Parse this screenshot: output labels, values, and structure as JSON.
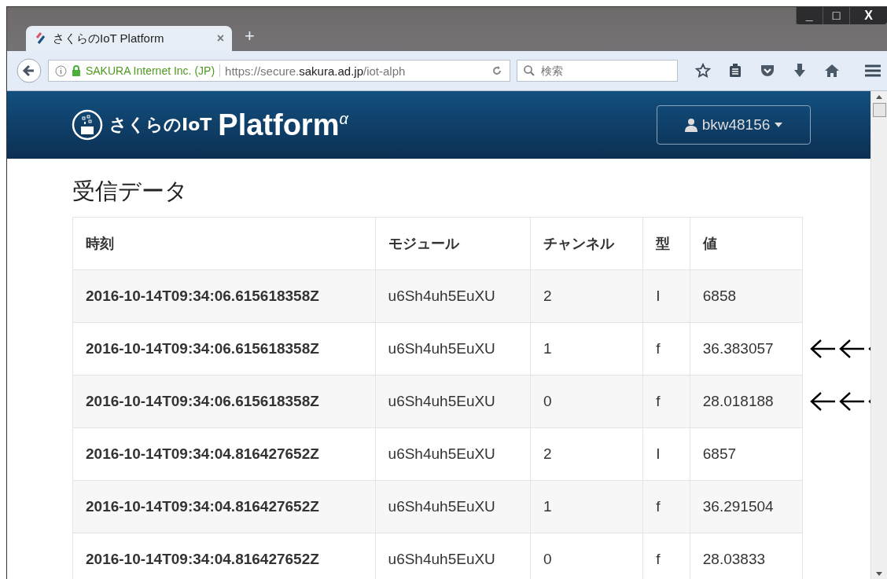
{
  "window": {
    "tab_title": "さくらのIoT Platform",
    "tab_close": "×",
    "new_tab": "+",
    "window_buttons": [
      "_",
      "□",
      "X"
    ]
  },
  "navbar": {
    "identity": "SAKURA Internet Inc. (JP)",
    "url_prefix": "https://secure.",
    "url_domain": "sakura.ad.jp",
    "url_path": "/iot-alph",
    "search": {
      "placeholder": "検索"
    }
  },
  "site": {
    "brand_small": "さくらのIoT",
    "brand_big": "Platform",
    "brand_sup": "α",
    "user": "bkw48156"
  },
  "page_title": "受信データ",
  "table": {
    "columns": [
      "時刻",
      "モジュール",
      "チャンネル",
      "型",
      "値"
    ],
    "rows": [
      {
        "cells": [
          "2016-10-14T09:34:06.615618358Z",
          "u6Sh4uh5EuXU",
          "2",
          "I",
          "6858"
        ],
        "marked": false
      },
      {
        "cells": [
          "2016-10-14T09:34:06.615618358Z",
          "u6Sh4uh5EuXU",
          "1",
          "f",
          "36.383057"
        ],
        "marked": true
      },
      {
        "cells": [
          "2016-10-14T09:34:06.615618358Z",
          "u6Sh4uh5EuXU",
          "0",
          "f",
          "28.018188"
        ],
        "marked": true
      },
      {
        "cells": [
          "2016-10-14T09:34:04.816427652Z",
          "u6Sh4uh5EuXU",
          "2",
          "I",
          "6857"
        ],
        "marked": false
      },
      {
        "cells": [
          "2016-10-14T09:34:04.816427652Z",
          "u6Sh4uh5EuXU",
          "1",
          "f",
          "36.291504"
        ],
        "marked": false
      },
      {
        "cells": [
          "2016-10-14T09:34:04.816427652Z",
          "u6Sh4uh5EuXU",
          "0",
          "f",
          "28.03833"
        ],
        "marked": false
      }
    ]
  }
}
